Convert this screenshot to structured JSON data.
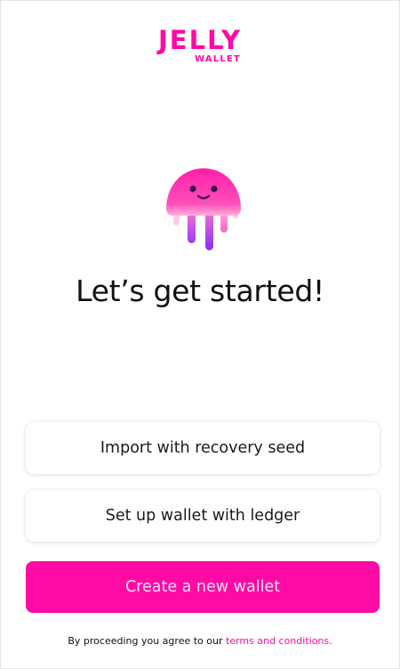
{
  "brand": {
    "name": "JELLY",
    "subname": "WALLET",
    "accent_color": "#ff0aa5"
  },
  "mascot": {
    "icon": "jellyfish-icon"
  },
  "headline": "Let’s get started!",
  "actions": {
    "import_label": "Import with recovery seed",
    "ledger_label": "Set up wallet with ledger",
    "create_label": "Create a new wallet"
  },
  "footer": {
    "text": "By proceeding you agree to our",
    "link_text": "terms and conditions",
    "suffix": "."
  }
}
